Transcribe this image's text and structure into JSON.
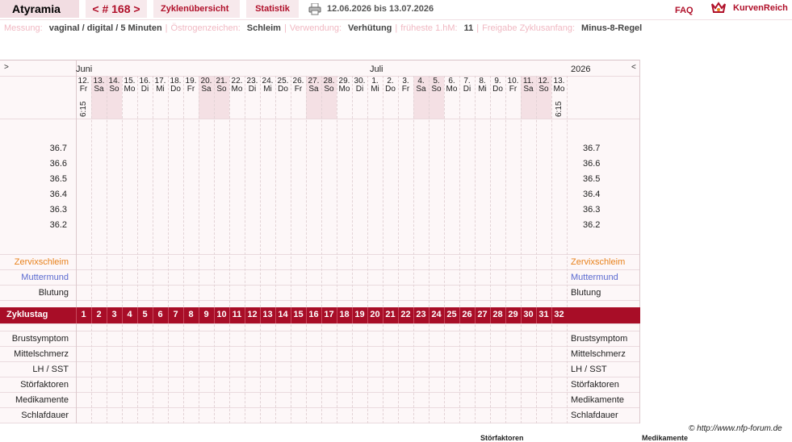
{
  "header": {
    "title": "Atyramia",
    "cycle_nav": "< # 168 >",
    "overview_tab": "Zyklenübersicht",
    "stats_tab": "Statistik",
    "date_range": "12.06.2026 bis 13.07.2026",
    "faq": "FAQ",
    "brand": "KurvenReich"
  },
  "settings": [
    {
      "label": "Messung:",
      "value": "vaginal / digital / 5 Minuten"
    },
    {
      "label": "Östrogenzeichen:",
      "value": "Schleim"
    },
    {
      "label": "Verwendung:",
      "value": "Verhütung"
    },
    {
      "label": "früheste 1.hM:",
      "value": "11"
    },
    {
      "label": "Freigabe Zyklusanfang:",
      "value": "Minus-8-Regel"
    }
  ],
  "chart": {
    "left_arrow": ">",
    "right_arrow": "<",
    "months": [
      {
        "name": "Juni"
      },
      {
        "name": "Juli"
      }
    ],
    "year": "2026",
    "days": [
      {
        "num": "12.",
        "name": "Fr",
        "weekend": false,
        "time": "6:15"
      },
      {
        "num": "13.",
        "name": "Sa",
        "weekend": true
      },
      {
        "num": "14.",
        "name": "So",
        "weekend": true
      },
      {
        "num": "15.",
        "name": "Mo",
        "weekend": false
      },
      {
        "num": "16.",
        "name": "Di",
        "weekend": false
      },
      {
        "num": "17.",
        "name": "Mi",
        "weekend": false
      },
      {
        "num": "18.",
        "name": "Do",
        "weekend": false
      },
      {
        "num": "19.",
        "name": "Fr",
        "weekend": false
      },
      {
        "num": "20.",
        "name": "Sa",
        "weekend": true
      },
      {
        "num": "21.",
        "name": "So",
        "weekend": true
      },
      {
        "num": "22.",
        "name": "Mo",
        "weekend": false
      },
      {
        "num": "23.",
        "name": "Di",
        "weekend": false
      },
      {
        "num": "24.",
        "name": "Mi",
        "weekend": false
      },
      {
        "num": "25.",
        "name": "Do",
        "weekend": false
      },
      {
        "num": "26.",
        "name": "Fr",
        "weekend": false
      },
      {
        "num": "27.",
        "name": "Sa",
        "weekend": true
      },
      {
        "num": "28.",
        "name": "So",
        "weekend": true
      },
      {
        "num": "29.",
        "name": "Mo",
        "weekend": false
      },
      {
        "num": "30.",
        "name": "Di",
        "weekend": false
      },
      {
        "num": "1.",
        "name": "Mi",
        "weekend": false
      },
      {
        "num": "2.",
        "name": "Do",
        "weekend": false
      },
      {
        "num": "3.",
        "name": "Fr",
        "weekend": false
      },
      {
        "num": "4.",
        "name": "Sa",
        "weekend": true
      },
      {
        "num": "5.",
        "name": "So",
        "weekend": true
      },
      {
        "num": "6.",
        "name": "Mo",
        "weekend": false
      },
      {
        "num": "7.",
        "name": "Di",
        "weekend": false
      },
      {
        "num": "8.",
        "name": "Mi",
        "weekend": false
      },
      {
        "num": "9.",
        "name": "Do",
        "weekend": false
      },
      {
        "num": "10.",
        "name": "Fr",
        "weekend": false
      },
      {
        "num": "11.",
        "name": "Sa",
        "weekend": true
      },
      {
        "num": "12.",
        "name": "So",
        "weekend": true
      },
      {
        "num": "13.",
        "name": "Mo",
        "weekend": false,
        "time": "6:15"
      }
    ],
    "temperatures": [
      "36.7",
      "36.6",
      "36.5",
      "36.4",
      "36.3",
      "36.2"
    ],
    "rows_top": [
      "Zervixschleim",
      "Muttermund",
      "Blutung"
    ],
    "cycle_label": "Zyklustag",
    "cycle_days": [
      "1",
      "2",
      "3",
      "4",
      "5",
      "6",
      "7",
      "8",
      "9",
      "10",
      "11",
      "12",
      "13",
      "14",
      "15",
      "16",
      "17",
      "18",
      "19",
      "20",
      "21",
      "22",
      "23",
      "24",
      "25",
      "26",
      "27",
      "28",
      "29",
      "30",
      "31",
      "32"
    ],
    "rows_bottom": [
      "Brustsymptom",
      "Mittelschmerz",
      "LH / SST",
      "Störfaktoren",
      "Medikamente",
      "Schlafdauer"
    ],
    "bleeding_end_marker": "•••",
    "colors": {
      "accent": "#b0102a",
      "cycle_bar": "#a80d27",
      "zervix": "#e8811a",
      "muttermund": "#5a6ad0",
      "weekend_bg": "#f4e0e4"
    }
  },
  "footer": {
    "copyright": "© http://www.nfp-forum.de",
    "cut_off_1": "Störfaktoren",
    "cut_off_2": "Medikamente"
  }
}
